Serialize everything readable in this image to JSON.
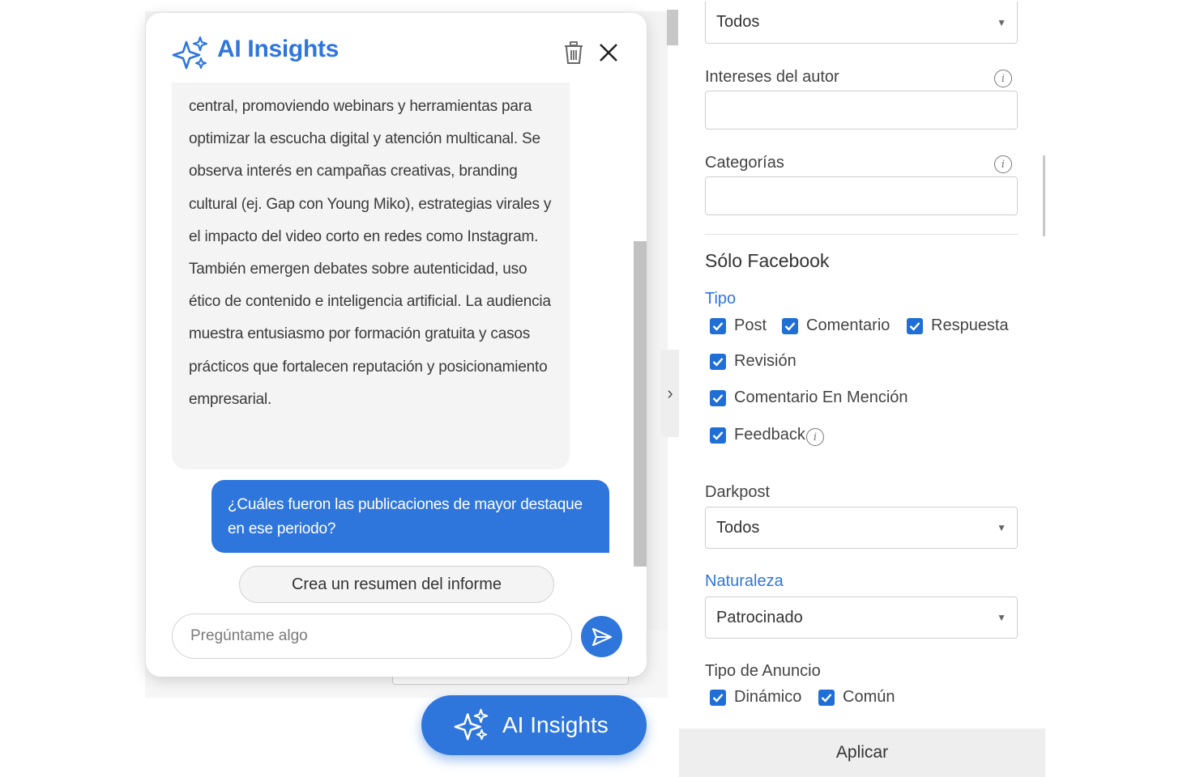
{
  "chat": {
    "title": "AI Insights",
    "ai_message": "central, promoviendo webinars y herramientas para optimizar la escucha digital y atención multicanal. Se observa interés en campañas creativas, branding cultural (ej. Gap con Young Miko), estrategias virales y el impacto del video corto en redes como Instagram. También emergen debates sobre autenticidad, uso ético de contenido e inteligencia artificial. La audiencia muestra entusiasmo por formación gratuita y casos prácticos que fortalecen reputación y posicionamiento empresarial.",
    "user_message": "¿Cuáles fueron las publicaciones de mayor destaque en ese periodo?",
    "suggestion": "Crea un resumen del informe",
    "input_placeholder": "Pregúntame algo"
  },
  "fab": {
    "label": "AI Insights"
  },
  "filters": {
    "top_select_value": "Todos",
    "author_interests_label": "Intereses del autor",
    "categories_label": "Categorías",
    "section_title": "Sólo Facebook",
    "tipo_label": "Tipo",
    "tipo_options": [
      {
        "label": "Post",
        "checked": true
      },
      {
        "label": "Comentario",
        "checked": true
      },
      {
        "label": "Respuesta",
        "checked": true
      },
      {
        "label": "Revisión",
        "checked": true
      },
      {
        "label": "Comentario En Mención",
        "checked": true
      },
      {
        "label": "Feedback",
        "checked": true
      }
    ],
    "darkpost_label": "Darkpost",
    "darkpost_value": "Todos",
    "naturaleza_label": "Naturaleza",
    "naturaleza_value": "Patrocinado",
    "ad_type_label": "Tipo de Anuncio",
    "ad_type_options": [
      {
        "label": "Dinámico",
        "checked": true
      },
      {
        "label": "Común",
        "checked": true
      }
    ],
    "apply_label": "Aplicar",
    "info_glyph": "i",
    "caret_glyph": "▼"
  },
  "colors": {
    "accent": "#2f76dc",
    "checkbox": "#1f6fd6"
  }
}
